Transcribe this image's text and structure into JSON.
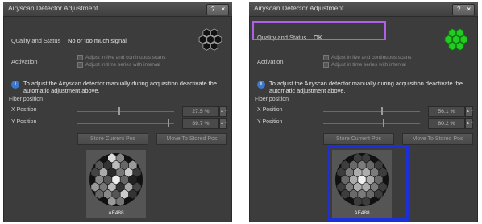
{
  "panels": [
    {
      "title": "Airyscan Detector Adjustment",
      "quality_label": "Quality and Status",
      "quality_value": "No or too much signal",
      "activation_label": "Activation",
      "check1": "Adjust in live and continuous scans",
      "check2": "Adjust in time series with interval",
      "note": "To adjust the Airyscan detector manually during acquisition deactivate the automatic adjustment above.",
      "fiber_label": "Fiber position",
      "x_label": "X Position",
      "x_value": "27.5 %",
      "y_label": "Y Position",
      "y_value": "89.7 %",
      "store_btn": "Store Current Pos",
      "move_btn": "Move To Stored Pos",
      "detector_caption": "AF488",
      "status_color": "#111111"
    },
    {
      "title": "Airyscan Detector Adjustment",
      "quality_label": "Quality and Status",
      "quality_value": "OK",
      "activation_label": "Activation",
      "check1": "Adjust in live and continuous scans",
      "check2": "Adjust in time series with interval",
      "note": "To adjust the Airyscan detector manually during acquisition deactivate the automatic adjustment above.",
      "fiber_label": "Fiber position",
      "x_label": "X Position",
      "x_value": "56.1 %",
      "y_label": "Y Position",
      "y_value": "60.2 %",
      "store_btn": "Store Current Pos",
      "move_btn": "Move To Stored Pos",
      "detector_caption": "AF488",
      "status_color": "#22cc22"
    }
  ],
  "icons": {
    "help": "?",
    "close": "×",
    "info": "i",
    "spin": "▲▼"
  },
  "highlight_colors": {
    "status_box": "#b05fe8",
    "detector_box": "#1c2fd8"
  }
}
